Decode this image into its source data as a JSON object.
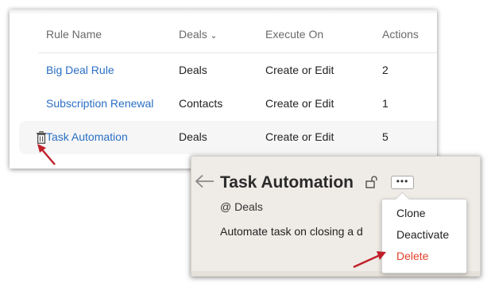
{
  "rules_table": {
    "headers": {
      "rule_name": "Rule Name",
      "module": "Deals",
      "execute_on": "Execute On",
      "actions": "Actions"
    },
    "rows": [
      {
        "rule_name": "Big Deal Rule",
        "module": "Deals",
        "execute_on": "Create or Edit",
        "actions": "2"
      },
      {
        "rule_name": "Subscription Renewal",
        "module": "Contacts",
        "execute_on": "Create or Edit",
        "actions": "1"
      },
      {
        "rule_name": "Task Automation",
        "module": "Deals",
        "execute_on": "Create or Edit",
        "actions": "5"
      }
    ]
  },
  "detail": {
    "title": "Task Automation",
    "module": "@ Deals",
    "description": "Automate task on closing a d",
    "more_label": "•••"
  },
  "menu": {
    "items": [
      "Clone",
      "Deactivate",
      "Delete"
    ]
  },
  "colors": {
    "link": "#2a6fc4",
    "danger": "#e0412c",
    "annotation_arrow": "#c0202a",
    "card_background": "#efebe6"
  },
  "icons": {
    "trash": "trash-icon",
    "back": "back-arrow-icon",
    "lock": "lock-icon",
    "sort": "chevron-down-icon"
  }
}
